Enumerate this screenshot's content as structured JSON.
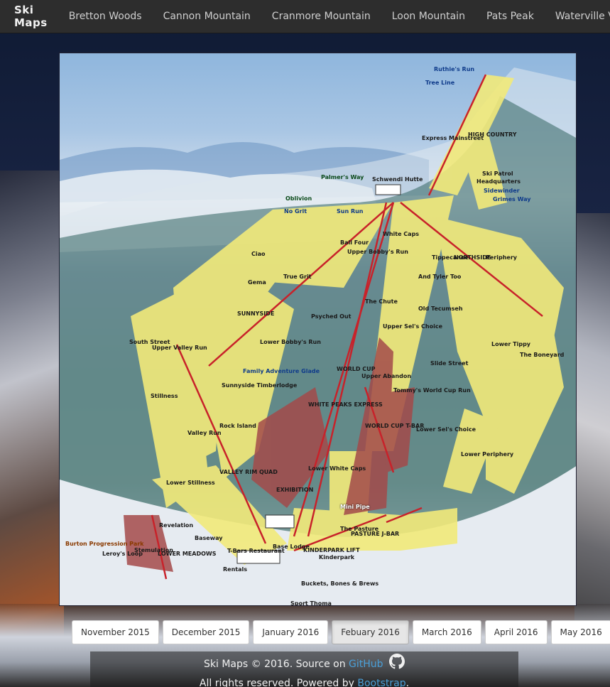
{
  "navbar": {
    "brand": "Ski Maps",
    "links": [
      "Bretton Woods",
      "Cannon Mountain",
      "Cranmore Mountain",
      "Loon Mountain",
      "Pats Peak",
      "Waterville Valley"
    ]
  },
  "map": {
    "labels": {
      "ruthies_run": "Ruthie's Run",
      "tree_line": "Tree Line",
      "schwendi_hutte": "Schwendi Hutte",
      "ski_patrol": "Ski Patrol",
      "headquarters": "Headquarters",
      "sidewinder": "Sidewinder",
      "grimes_way": "Grimes Way",
      "palmers_way": "Palmer's Way",
      "oblivion": "Oblivion",
      "no_grit": "No Grit",
      "sun_run": "Sun Run",
      "ciao": "Ciao",
      "gema": "Gema",
      "true_grit": "True Grit",
      "sunnyside": "SUNNYSIDE",
      "lower_bobbys_run": "Lower Bobby's Run",
      "psyched_out": "Psyched Out",
      "the_chute": "The Chute",
      "upper_bobbys_run": "Upper Bobby's Run",
      "white_caps": "White Caps",
      "ball_four": "Ball Four",
      "high_country": "HIGH COUNTRY",
      "express_mainstreet": "Express Mainstreet",
      "northside": "NORTHSIDE",
      "tippecanoe": "Tippecanoe",
      "periphery": "Periphery",
      "and_tyler_too": "And Tyler Too",
      "old_tecumseh": "Old Tecumseh",
      "lower_tippy": "Lower Tippy",
      "the_boneyard": "The Boneyard",
      "upper_sels_choice": "Upper Sel's Choice",
      "upper_abandon": "Upper Abandon",
      "tommys_world_cup_run": "Tommy's World Cup Run",
      "lower_sels_choice": "Lower Sel's Choice",
      "lower_periphery": "Lower Periphery",
      "slide_street": "Slide Street",
      "family_adventure_glade": "Family Adventure Glade",
      "sunnyside_timberlodge": "Sunnyside Timberlodge",
      "upper_valley_run": "Upper Valley Run",
      "south_street": "South Street",
      "stillness": "Stillness",
      "valley_run": "Valley Run",
      "rock_island": "Rock Island",
      "valley_rim_quad": "VALLEY RIM QUAD",
      "lower_stillness": "Lower Stillness",
      "white_peaks_express": "WHITE PEAKS EXPRESS",
      "world_cup": "WORLD CUP",
      "exhibition": "EXHIBITION",
      "lower_white_caps": "Lower White Caps",
      "world_cup_bar": "WORLD CUP T-BAR",
      "mini_pipe": "Mini Pipe",
      "the_pasture": "The Pasture",
      "pasture_jbar": "PASTURE J-BAR",
      "kinderpark_lift": "KINDERPARK LIFT",
      "kinderpark": "Kinderpark",
      "base_lodge": "Base Lodge",
      "tbars_restaurant": "T-Bars Restaurant",
      "rentals": "Rentals",
      "buckets": "Buckets, Bones & Brews",
      "sport_thoma": "Sport Thoma",
      "revelation": "Revelation",
      "baseway": "Baseway",
      "lower_meadows": "LOWER MEADOWS",
      "stemulation": "Stemulation",
      "leroys_loop": "Leroy's Loop",
      "burton_progression_park": "Burton Progression Park"
    }
  },
  "months": {
    "items": [
      "November 2015",
      "December 2015",
      "January 2016",
      "Febuary 2016",
      "March 2016",
      "April 2016",
      "May 2016"
    ],
    "active_index": 3
  },
  "footer": {
    "line1_prefix": "Ski Maps © 2016. Source on ",
    "github": "GitHub",
    "line2_prefix": "All rights reserved. Powered by ",
    "bootstrap": "Bootstrap",
    "line2_suffix": "."
  },
  "colors": {
    "trail_yellow": "#f2ea7a",
    "lift_red": "#c8222a",
    "park_red": "#a34a4a",
    "navbar_bg": "#2d2d2d",
    "link_blue": "#4a9fd8"
  }
}
